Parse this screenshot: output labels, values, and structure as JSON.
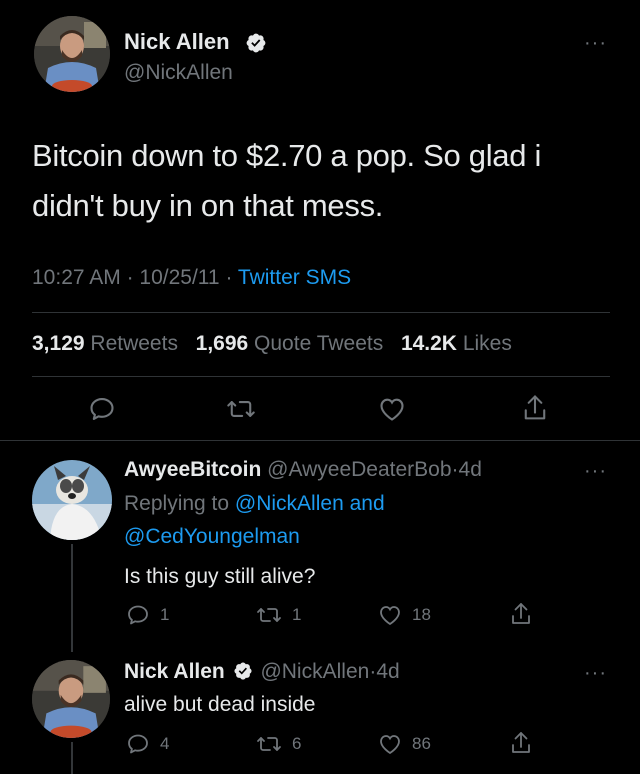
{
  "main_tweet": {
    "author_name": "Nick Allen",
    "author_handle": "@NickAllen",
    "text_line1": "Bitcoin down to $2.70 a pop. So glad i",
    "text_line2": "didn't buy in on that mess.",
    "time": "10:27 AM",
    "date": "10/25/11",
    "source": "Twitter SMS",
    "retweets_count": "3,129",
    "retweets_label": "Retweets",
    "quotes_count": "1,696",
    "quotes_label": "Quote Tweets",
    "likes_count": "14.2K",
    "likes_label": "Likes",
    "more": "···"
  },
  "replies": [
    {
      "author_name": "AwyeeBitcoin",
      "author_handle": "@AwyeeDeaterBob",
      "age": "4d",
      "replying_prefix": "Replying to",
      "replying_to_1": "@NickAllen and",
      "replying_to_2": "@CedYoungelman",
      "text": "Is this guy still alive?",
      "reply_count": "1",
      "retweet_count": "1",
      "like_count": "18",
      "more": "···"
    },
    {
      "author_name": "Nick Allen",
      "author_handle": "@NickAllen",
      "age": "4d",
      "text": "alive but dead inside",
      "reply_count": "4",
      "retweet_count": "6",
      "like_count": "86",
      "more": "···"
    }
  ],
  "dot": "·",
  "colors": {
    "accent": "#1d9bf0",
    "muted": "#71767b",
    "background": "#000000",
    "text": "#e7e9ea"
  },
  "icons": [
    "verified-badge-icon",
    "more-icon",
    "reply-icon",
    "retweet-icon",
    "like-icon",
    "share-icon"
  ]
}
